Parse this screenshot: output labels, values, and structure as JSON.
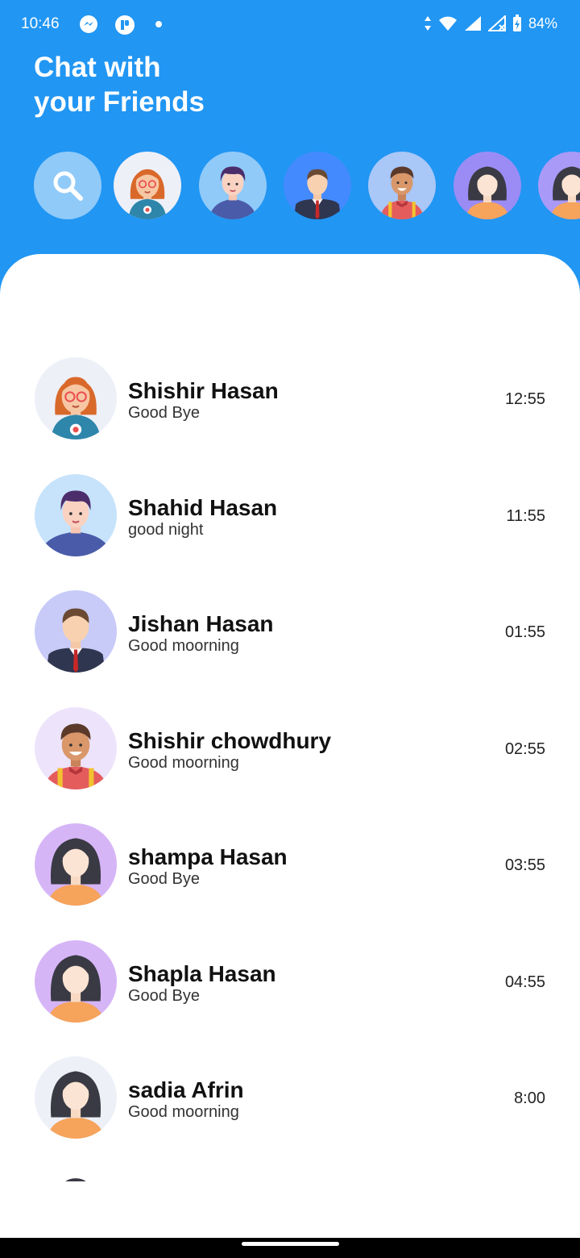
{
  "status_bar": {
    "time": "10:46",
    "left_icons": [
      "messenger-icon",
      "app-icon",
      "dot-icon"
    ],
    "right_icons": [
      "data-arrows-icon",
      "wifi-icon",
      "signal-icon",
      "signal-x-icon",
      "battery-charging-icon"
    ],
    "battery": "84%"
  },
  "header": {
    "title_line1": "Chat with",
    "title_line2": "your Friends"
  },
  "stories": [
    {
      "icon": "search-icon",
      "bg": "#90CAF9"
    },
    {
      "avatar": "girl-glasses",
      "bg": "#EEF0F8"
    },
    {
      "avatar": "boy-purple",
      "bg": "#90CAF9"
    },
    {
      "avatar": "man-suit",
      "bg": "#448AFF"
    },
    {
      "avatar": "man-suspenders",
      "bg": "#A9C7F7"
    },
    {
      "avatar": "woman-dark-hair",
      "bg": "#9B8CF5"
    },
    {
      "avatar": "woman-dark-hair",
      "bg": "#A99AF8"
    }
  ],
  "chats": [
    {
      "name": "Shishir Hasan",
      "message": "Good Bye",
      "time": "12:55",
      "avatar": "girl-glasses",
      "bg": "#EEF0F8"
    },
    {
      "name": "Shahid Hasan",
      "message": "good night",
      "time": "11:55",
      "avatar": "boy-purple",
      "bg": "#C7E3FB"
    },
    {
      "name": "Jishan Hasan",
      "message": "Good moorning",
      "time": "01:55",
      "avatar": "man-suit",
      "bg": "#C8CBF8"
    },
    {
      "name": "Shishir chowdhury",
      "message": "Good moorning",
      "time": "02:55",
      "avatar": "man-suspenders",
      "bg": "#EDE4FB"
    },
    {
      "name": "shampa Hasan",
      "message": "Good Bye",
      "time": "03:55",
      "avatar": "woman-dark-hair",
      "bg": "#D6B5F7"
    },
    {
      "name": "Shapla Hasan",
      "message": "Good Bye",
      "time": "04:55",
      "avatar": "woman-dark-hair",
      "bg": "#D6B5F7"
    },
    {
      "name": "sadia Afrin",
      "message": "Good moorning",
      "time": "8:00",
      "avatar": "woman-dark-hair",
      "bg": "#EEF0F8"
    },
    {
      "name": "",
      "message": "",
      "time": "",
      "avatar": "partial-avatar",
      "bg": "#FFFFFF"
    }
  ],
  "colors": {
    "primary": "#2196F3",
    "panel": "#FFFFFF"
  }
}
